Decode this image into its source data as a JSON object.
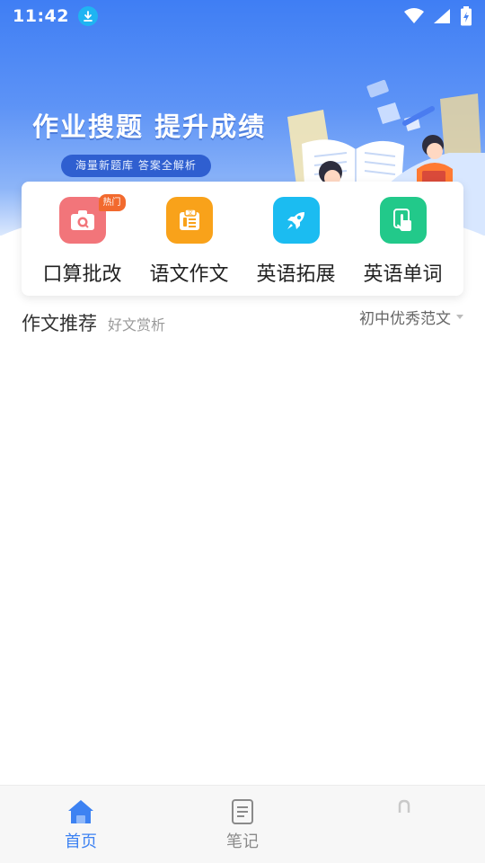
{
  "status_bar": {
    "time": "11:42",
    "icons": [
      "download-icon",
      "wifi-icon",
      "signal-icon",
      "battery-charging-icon"
    ]
  },
  "hero": {
    "title": "作业搜题 提升成绩",
    "subtitle": "海量新题库  答案全解析"
  },
  "features": [
    {
      "label": "口算批改",
      "icon": "camera-icon",
      "color": "#f2757a",
      "badge": "热门"
    },
    {
      "label": "语文作文",
      "icon": "document-icon",
      "color": "#f9a21a"
    },
    {
      "label": "英语拓展",
      "icon": "rocket-icon",
      "color": "#1bbcf1"
    },
    {
      "label": "英语单词",
      "icon": "tap-icon",
      "color": "#22c98a"
    }
  ],
  "section": {
    "title": "作文推荐",
    "subtitle": "好文赏析",
    "filter": "初中优秀范文"
  },
  "bottom_nav": [
    {
      "label": "首页",
      "icon": "home-icon",
      "active": true
    },
    {
      "label": "笔记",
      "icon": "notes-icon",
      "active": false
    },
    {
      "label": "",
      "icon": "profile-icon",
      "active": false
    }
  ],
  "colors": {
    "primary": "#3d82f2",
    "hero_top": "#3f7ef4",
    "badge": "#f26a2e"
  }
}
